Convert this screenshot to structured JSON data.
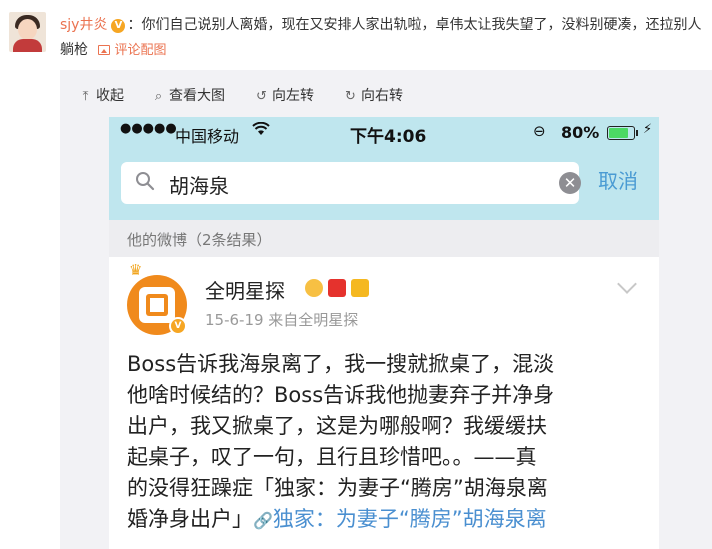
{
  "comment": {
    "username": "sjy井炎",
    "badge": "V",
    "text": "：你们自己说别人离婚，现在又安排人家出轨啦，卓伟太让我失望了，没料别硬凑，还拉别人躺枪",
    "pic_link": "评论配图"
  },
  "toolbar": {
    "collapse": "收起",
    "view_large": "查看大图",
    "rotate_left": "向左转",
    "rotate_right": "向右转"
  },
  "screenshot": {
    "status": {
      "signal": "●●●●●",
      "carrier": "中国移动",
      "time": "下午4:06",
      "battery_text": "80%",
      "battery_level": 0.8
    },
    "search": {
      "query": "胡海泉",
      "cancel": "取消"
    },
    "section_header": "他的微博（2条结果）",
    "post": {
      "author": "全明星探",
      "meta": "15-6-19  来自全明星探",
      "line1": "Boss告诉我海泉离了，我一搜就掀桌了，混淡",
      "line2": "他啥时候结的？Boss告诉我他抛妻弃子并净身",
      "line3": "出户，我又掀桌了，这是为哪般啊？我缓缓扶",
      "line4": "起桌子，叹了一句，且行且珍惜吧。。——真",
      "line5": "的没得狂躁症「独家：为妻子“腾房”胡海泉离",
      "line6_text": "婚净身出户」",
      "line6_link": "独家：为妻子“腾房”胡海泉离"
    }
  }
}
